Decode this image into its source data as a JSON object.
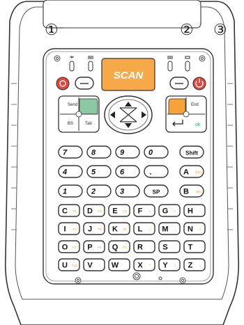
{
  "callouts": [
    "①",
    "②",
    "③"
  ],
  "scan_label": "SCAN",
  "nav_keys": {
    "send": "Send",
    "end": "End",
    "bs": "BS",
    "tab": "Tab",
    "ok": "ok"
  },
  "grid_keys": [
    {
      "main": "7",
      "sub": ""
    },
    {
      "main": "8",
      "sub": ""
    },
    {
      "main": "9",
      "sub": ""
    },
    {
      "main": "0",
      "sub": ""
    },
    {
      "main": "Shift",
      "sub": ""
    },
    {
      "main": "4",
      "sub": ""
    },
    {
      "main": "5",
      "sub": ""
    },
    {
      "main": "6",
      "sub": ""
    },
    {
      "main": ".",
      "sub": ""
    },
    {
      "main": "A",
      "sub": "ESC"
    },
    {
      "main": "1",
      "sub": ""
    },
    {
      "main": "2",
      "sub": ""
    },
    {
      "main": "3",
      "sub": ""
    },
    {
      "main": "SP",
      "sub": ""
    },
    {
      "main": "B",
      "sub": "Win"
    },
    {
      "main": "C",
      "sub": "F1"
    },
    {
      "main": "D",
      "sub": "F2"
    },
    {
      "main": "E",
      "sub": "F3"
    },
    {
      "main": "F",
      "sub": "<"
    },
    {
      "main": "G",
      "sub": ">"
    },
    {
      "main": "H",
      "sub": "-"
    },
    {
      "main": "I",
      "sub": "F4"
    },
    {
      "main": "J",
      "sub": "F5"
    },
    {
      "main": "K",
      "sub": "F6"
    },
    {
      "main": "L",
      "sub": "|"
    },
    {
      "main": "M",
      "sub": ","
    },
    {
      "main": "N",
      "sub": "?"
    },
    {
      "main": "O",
      "sub": "F7"
    },
    {
      "main": "P",
      "sub": "F8"
    },
    {
      "main": "Q",
      "sub": "F9"
    },
    {
      "main": "R",
      "sub": ":"
    },
    {
      "main": "S",
      "sub": ";"
    },
    {
      "main": "T",
      "sub": "'"
    },
    {
      "main": "U",
      "sub": "F10"
    },
    {
      "main": "V",
      "sub": "+"
    },
    {
      "main": "W",
      "sub": "-"
    },
    {
      "main": "X",
      "sub": "*"
    },
    {
      "main": "Y",
      "sub": "/"
    },
    {
      "main": "Z",
      "sub": "="
    }
  ],
  "colors": {
    "scan": "#f7a94a",
    "green": "#8bc9a2",
    "orange": "#f6a33a",
    "power": "#e8453c",
    "teal": "#2aa888"
  }
}
